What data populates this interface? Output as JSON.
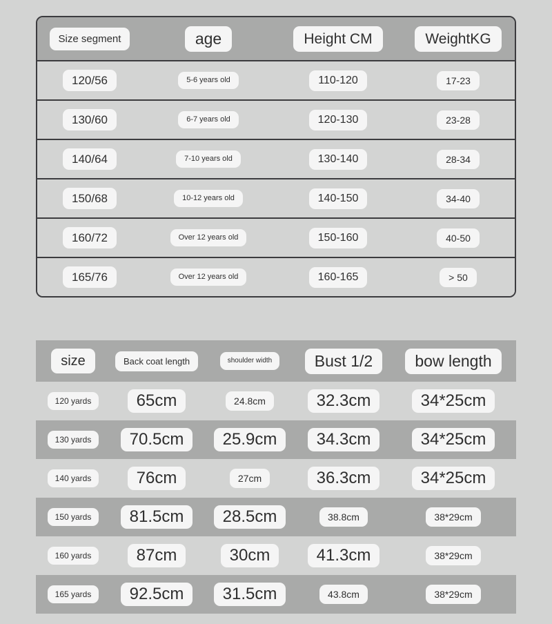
{
  "size_chart_table": {
    "columns": [
      "Size segment",
      "age",
      "Height CM",
      "WeightKG"
    ],
    "rows": [
      {
        "size_segment": "120/56",
        "age": "5-6 years old",
        "height_cm": "110-120",
        "weight_kg": "17-23"
      },
      {
        "size_segment": "130/60",
        "age": "6-7 years old",
        "height_cm": "120-130",
        "weight_kg": "23-28"
      },
      {
        "size_segment": "140/64",
        "age": "7-10 years old",
        "height_cm": "130-140",
        "weight_kg": "28-34"
      },
      {
        "size_segment": "150/68",
        "age": "10-12 years old",
        "height_cm": "140-150",
        "weight_kg": "34-40"
      },
      {
        "size_segment": "160/72",
        "age": "Over 12 years old",
        "height_cm": "150-160",
        "weight_kg": "40-50"
      },
      {
        "size_segment": "165/76",
        "age": "Over 12 years old",
        "height_cm": "160-165",
        "weight_kg": "> 50"
      }
    ]
  },
  "garment_measurement_table": {
    "columns": [
      "size",
      "Back coat length",
      "shoulder width",
      "Bust 1/2",
      "bow length"
    ],
    "rows": [
      {
        "size": "120 yards",
        "back_coat_length": "65cm",
        "shoulder_width": "24.8cm",
        "bust_half": "32.3cm",
        "bow_length": "34*25cm"
      },
      {
        "size": "130 yards",
        "back_coat_length": "70.5cm",
        "shoulder_width": "25.9cm",
        "bust_half": "34.3cm",
        "bow_length": "34*25cm"
      },
      {
        "size": "140 yards",
        "back_coat_length": "76cm",
        "shoulder_width": "27cm",
        "bust_half": "36.3cm",
        "bow_length": "34*25cm"
      },
      {
        "size": "150 yards",
        "back_coat_length": "81.5cm",
        "shoulder_width": "28.5cm",
        "bust_half": "38.8cm",
        "bow_length": "38*29cm"
      },
      {
        "size": "160 yards",
        "back_coat_length": "87cm",
        "shoulder_width": "30cm",
        "bust_half": "41.3cm",
        "bow_length": "38*29cm"
      },
      {
        "size": "165 yards",
        "back_coat_length": "92.5cm",
        "shoulder_width": "31.5cm",
        "bust_half": "43.8cm",
        "bow_length": "38*29cm"
      }
    ]
  },
  "colors": {
    "page_background": "#d3d4d3",
    "header_band": "#a9aaa9",
    "table_border": "#3b3b3e",
    "pill_background": "#f5f5f5",
    "text": "#2f2f2f"
  }
}
